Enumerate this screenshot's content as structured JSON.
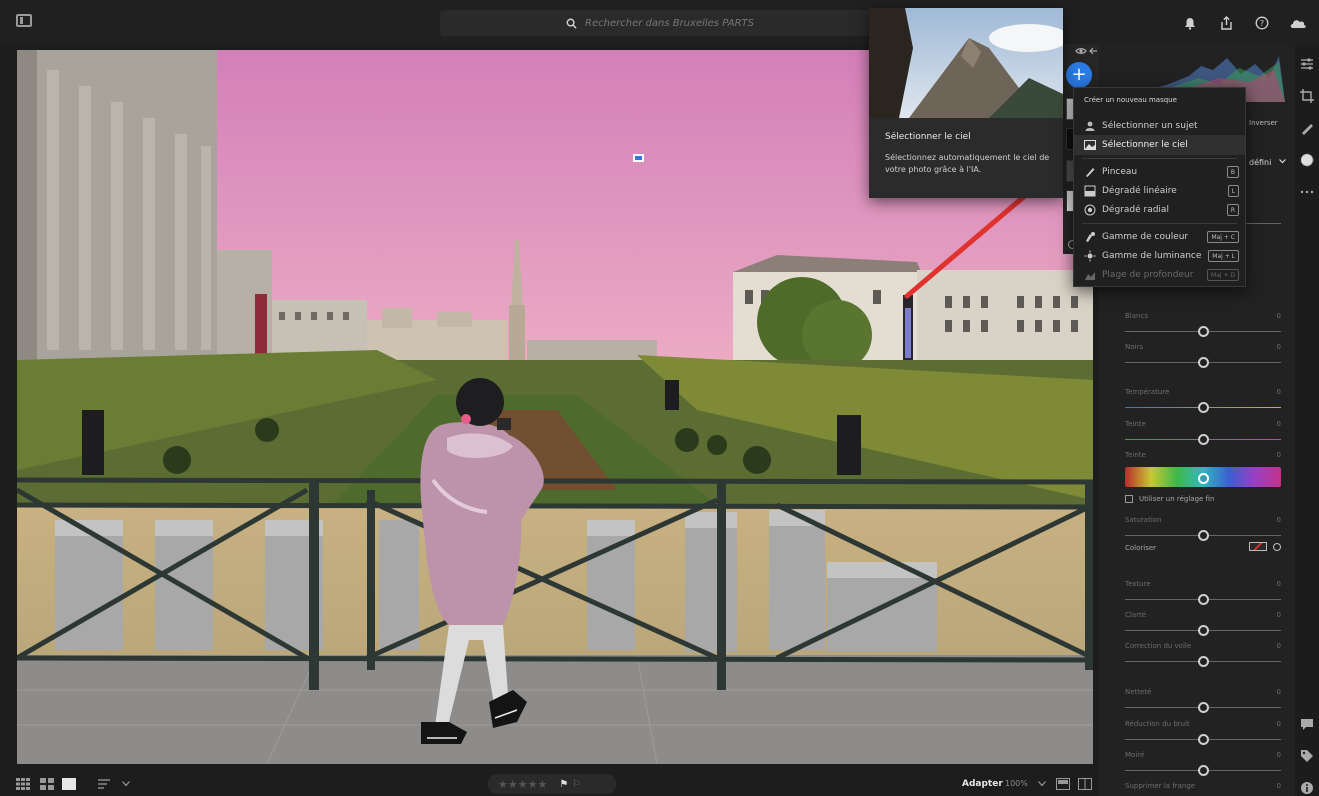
{
  "search": {
    "placeholder": "Rechercher dans Bruxelles PARTS"
  },
  "mask_menu": {
    "header": "Créer un nouveau masque",
    "items": [
      {
        "label": "Sélectionner un sujet",
        "icon": "person-icon",
        "selected": false,
        "shortcut": ""
      },
      {
        "label": "Sélectionner le ciel",
        "icon": "sky-icon",
        "selected": true,
        "shortcut": ""
      },
      {
        "label": "Pinceau",
        "icon": "brush-icon",
        "selected": false,
        "shortcut": "B"
      },
      {
        "label": "Dégradé linéaire",
        "icon": "linear-gradient-icon",
        "selected": false,
        "shortcut": "L"
      },
      {
        "label": "Dégradé radial",
        "icon": "radial-gradient-icon",
        "selected": false,
        "shortcut": "R"
      },
      {
        "label": "Gamme de couleur",
        "icon": "color-range-icon",
        "selected": false,
        "shortcut": "Maj + C"
      },
      {
        "label": "Gamme de luminance",
        "icon": "luminance-range-icon",
        "selected": false,
        "shortcut": "Maj + L"
      },
      {
        "label": "Plage de profondeur",
        "icon": "depth-range-icon",
        "selected": false,
        "shortcut": "Maj + D"
      }
    ]
  },
  "tooltip": {
    "title": "Sélectionner le ciel",
    "description": "Sélectionnez automatiquement le ciel de votre photo grâce à l'IA."
  },
  "right_panel": {
    "invert_label": "Inverser",
    "preset_label": "défini",
    "sliders": [
      {
        "label": "Blancs",
        "value": "0"
      },
      {
        "label": "Noirs",
        "value": "0"
      },
      {
        "label": "Température",
        "value": "0"
      },
      {
        "label": "Teinte",
        "value": "0"
      },
      {
        "label": "Teinte",
        "value": "0"
      },
      {
        "label": "Saturation",
        "value": "0"
      },
      {
        "label": "Texture",
        "value": "0"
      },
      {
        "label": "Clarté",
        "value": "0"
      },
      {
        "label": "Correction du voile",
        "value": "0"
      },
      {
        "label": "Netteté",
        "value": "0"
      },
      {
        "label": "Réduction du bruit",
        "value": "0"
      },
      {
        "label": "Moiré",
        "value": "0"
      },
      {
        "label": "Supprimer la frange",
        "value": "0"
      }
    ],
    "fine_tune_label": "Utiliser un réglage fin",
    "colorize_label": "Coloriser"
  },
  "bottom_bar": {
    "stars": "★★★★★",
    "fit_label": "Adapter",
    "zoom_value": "100%"
  },
  "colors": {
    "accent": "#2b7ce5",
    "sky_mask": "#e3a3c6",
    "arrow": "#e0322e"
  }
}
